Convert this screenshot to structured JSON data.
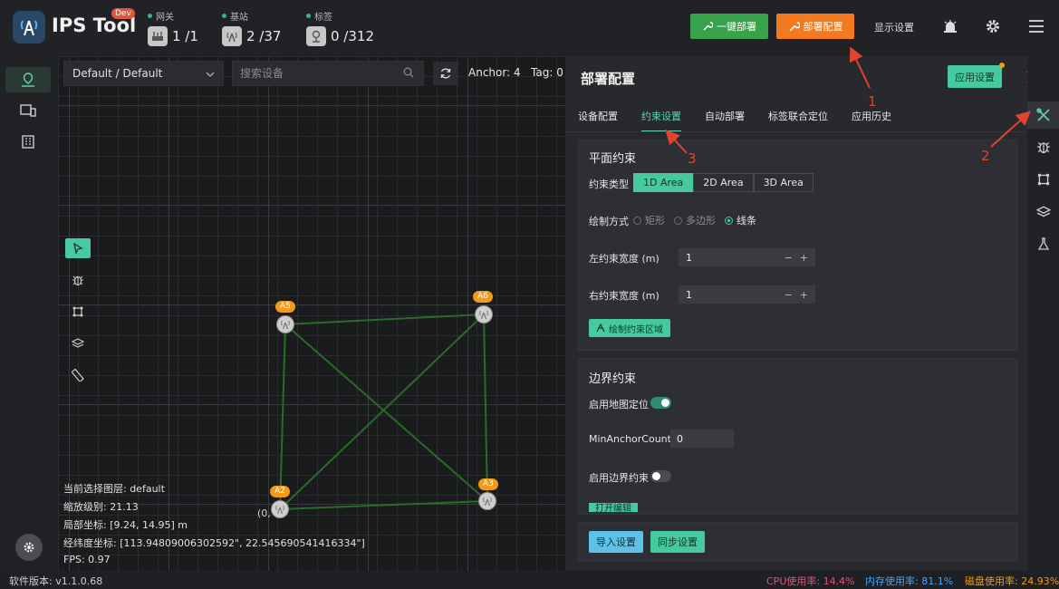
{
  "app": {
    "title": "IPS Tool",
    "badge": "Dev"
  },
  "stats": [
    {
      "label": "网关",
      "value": "1 /1",
      "icon": "router-icon"
    },
    {
      "label": "基站",
      "value": "2 /37",
      "icon": "antenna-icon"
    },
    {
      "label": "标签",
      "value": "0 /312",
      "icon": "tag-pin-icon"
    }
  ],
  "header": {
    "one_click_deploy": "一键部署",
    "deploy_config": "部署配置",
    "display_settings": "显示设置"
  },
  "toolbar": {
    "layer_select": "Default / Default",
    "search_placeholder": "搜索设备",
    "anchor_count": "Anchor: 4",
    "tag_count": "Tag: 0"
  },
  "anchors": [
    "A5",
    "A6",
    "A2",
    "A3"
  ],
  "origin_label": "(0,",
  "info": {
    "layer": "当前选择图层:  default",
    "zoom": "缩放级别:  21.13",
    "local": "局部坐标:  [9.24, 14.95] m",
    "geo": "经纬度坐标:  [113.94809006302592\", 22.545690541416334\"]",
    "fps": "FPS:  0.97"
  },
  "panel": {
    "title": "部署配置",
    "apply": "应用设置",
    "tabs": [
      "设备配置",
      "约束设置",
      "自动部署",
      "标签联合定位",
      "应用历史"
    ],
    "plane": {
      "title": "平面约束",
      "type_label": "约束类型",
      "types": [
        "1D Area",
        "2D Area",
        "3D Area"
      ],
      "draw_mode_label": "绘制方式",
      "draw_modes": [
        "矩形",
        "多边形",
        "线条"
      ],
      "left_width_label": "左约束宽度 (m)",
      "left_width": "1",
      "right_width_label": "右约束宽度 (m)",
      "right_width": "1",
      "draw_button": "绘制约束区域"
    },
    "boundary": {
      "title": "边界约束",
      "map_locate_label": "启用地图定位",
      "map_locate_on": true,
      "min_anchor_label": "MinAnchorCount",
      "min_anchor_value": "0",
      "boundary_label": "启用边界约束",
      "boundary_on": false,
      "partial_button": "打开编辑"
    },
    "import": "导入设置",
    "sync": "同步设置"
  },
  "status": {
    "version": "软件版本:  v1.1.0.68",
    "cpu": "CPU使用率:  14.4%",
    "mem": "内存使用率:  81.1%",
    "disk": "磁盘使用率:  24.93%"
  },
  "annotations": [
    "1",
    "2",
    "3"
  ],
  "colors": {
    "accent": "#47c9a0",
    "orange": "#f37a1f",
    "green": "#37a249",
    "annotation": "#e0432f"
  }
}
